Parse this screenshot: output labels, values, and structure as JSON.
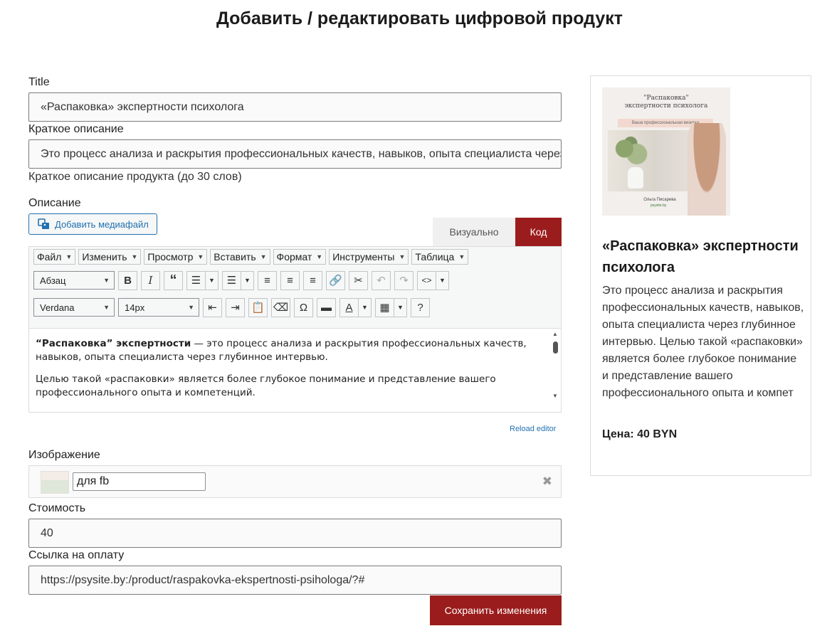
{
  "page": {
    "title": "Добавить / редактировать цифровой продукт"
  },
  "form": {
    "title_label": "Title",
    "title_value": "«Распаковка» экспертности психолога",
    "short_desc_label": "Краткое описание",
    "short_desc_value": "Это процесс анализа и раскрытия профессиональных качеств, навыков, опыта специалиста через глубинное интервью.",
    "short_desc_hint": "Краткое описание продукта (до 30 слов)",
    "description_label": "Описание",
    "add_media_label": "Добавить медиафайл",
    "tab_visual": "Визуально",
    "tab_code": "Код",
    "menu": [
      "Файл",
      "Изменить",
      "Просмотр",
      "Вставить",
      "Формат",
      "Инструменты",
      "Таблица"
    ],
    "format_select": "Абзац",
    "font_select": "Verdana",
    "size_select": "14px",
    "content": {
      "p1_bold": "“Распаковка” экспертности",
      "p1_rest": " — это процесс анализа и раскрытия профессиональных качеств, навыков, опыта специалиста через глубинное интервью.",
      "p2": "Целью такой «распаковки» является более глубокое понимание и представление вашего профессионального опыта и компетенций."
    },
    "reload_editor": "Reload editor",
    "image_label": "Изображение",
    "image_name": "для fb",
    "cost_label": "Стоимость",
    "cost_value": "40",
    "pay_link_label": "Ссылка на оплату",
    "pay_link_value": "https://psysite.by:/product/raspakovka-ekspertnosti-psihologa/?#",
    "save_label": "Сохранить изменения"
  },
  "preview": {
    "image_text": {
      "line1": "\"Распаковка\"",
      "line2": "экспертности психолога",
      "band": "Ваша профессиональная визитка",
      "author": "Ольга Писарева",
      "logo": "psysite.by"
    },
    "title": "«Распаковка» экспертности психолога",
    "description": "Это процесс анализа и раскрытия профессиональных качеств, навыков, опыта специалиста через глубинное интервью. Целью такой «распаковки» является более глубокое понимание и представление вашего профессионального опыта и компет",
    "price": "Цена: 40 BYN"
  },
  "colors": {
    "accent": "#9b1c1c",
    "link": "#2271b1"
  }
}
